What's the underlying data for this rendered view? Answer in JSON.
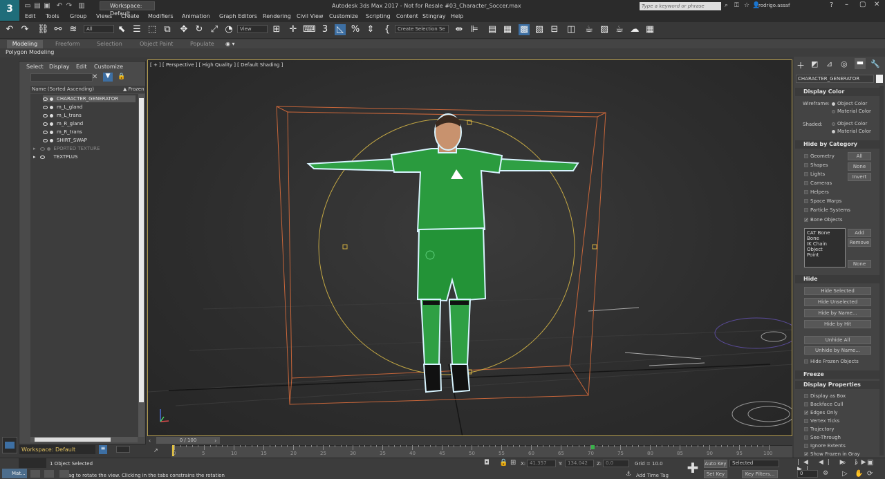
{
  "app": {
    "logo_text": "3",
    "workspace_top": "Workspace: Default",
    "window_title": "Autodesk 3ds Max 2017 - Not for Resale    #03_Character_Soccer.max",
    "search_placeholder": "Type a keyword or phrase",
    "user": "rodrigo.assaf"
  },
  "menu": [
    "Edit",
    "Tools",
    "Group",
    "Views",
    "Create",
    "Modifiers",
    "Animation",
    "Graph Editors",
    "Rendering",
    "Civil View",
    "Customize",
    "Scripting",
    "Content",
    "Stingray",
    "Help"
  ],
  "toolbar": {
    "filter_select": "All",
    "view_select": "View",
    "selection_set": "Create Selection Se"
  },
  "ribbon": {
    "tabs": [
      "Modeling",
      "Freeform",
      "Selection",
      "Object Paint",
      "Populate"
    ],
    "sub_label": "Polygon Modeling"
  },
  "explorer": {
    "menu": [
      "Select",
      "Display",
      "Edit",
      "Customize"
    ],
    "col_name": "Name (Sorted Ascending)",
    "col_frozen": "▲ Frozen",
    "rows": [
      {
        "name": "CHARACTER_GENERATOR",
        "grey": false
      },
      {
        "name": "m_L_gland",
        "grey": false
      },
      {
        "name": "m_L_trans",
        "grey": false
      },
      {
        "name": "m_R_gland",
        "grey": false
      },
      {
        "name": "m_R_trans",
        "grey": false
      },
      {
        "name": "SHIRT_SWAP",
        "grey": false
      },
      {
        "name": "EPORTED TEXTURE",
        "grey": true
      },
      {
        "name": "TEXTPLUS",
        "grey": false
      }
    ]
  },
  "viewport": {
    "label": "[ + ] [ Perspective ] [ High Quality ] [ Default Shading ]"
  },
  "command_panel": {
    "object_name": "CHARACTER_GENERATOR",
    "display_color": {
      "title": "Display Color",
      "wireframe_label": "Wireframe:",
      "shaded_label": "Shaded:",
      "object_color": "Object Color",
      "material_color": "Material Color"
    },
    "hide_by_category": {
      "title": "Hide by Category",
      "items": [
        "Geometry",
        "Shapes",
        "Lights",
        "Cameras",
        "Helpers",
        "Space Warps",
        "Particle Systems",
        "Bone Objects"
      ],
      "btn_all": "All",
      "btn_none": "None",
      "btn_invert": "Invert",
      "list": [
        "CAT Bone",
        "Bone",
        "IK Chain Object",
        "Point"
      ],
      "btn_add": "Add",
      "btn_remove": "Remove",
      "btn_none2": "None"
    },
    "hide": {
      "title": "Hide",
      "buttons": [
        "Hide Selected",
        "Hide Unselected",
        "Hide by Name...",
        "Hide by Hit",
        "Unhide All",
        "Unhide by Name..."
      ],
      "hide_frozen": "Hide Frozen Objects"
    },
    "freeze": {
      "title": "Freeze"
    },
    "display_properties": {
      "title": "Display Properties",
      "items": [
        "Display as Box",
        "Backface Cull",
        "Edges Only",
        "Vertex Ticks",
        "Trajectory",
        "See-Through",
        "Ignore Extents",
        "Show Frozen in Gray"
      ]
    }
  },
  "timeline": {
    "slider": "0 / 100",
    "ticks": [
      "0",
      "5",
      "10",
      "15",
      "20",
      "25",
      "30",
      "35",
      "40",
      "45",
      "50",
      "55",
      "60",
      "65",
      "70",
      "75",
      "80",
      "85",
      "90",
      "95",
      "100"
    ]
  },
  "status": {
    "workspace": "Workspace: Default",
    "selected": "1 Object Selected",
    "prompt": "rag to rotate the view.  Clicking in the tabs constrains the rotation",
    "mat": "Mat...",
    "x_label": "X:",
    "x_val": "41.357",
    "y_label": "Y:",
    "y_val": "134.042",
    "z_label": "Z:",
    "z_val": "0.0",
    "grid": "Grid = 10.0",
    "add_time_tag": "Add Time Tag",
    "auto_key": "Auto Key",
    "set_key": "Set Key",
    "selected_dd": "Selected",
    "key_filters": "Key Filters...",
    "frame": "0"
  }
}
